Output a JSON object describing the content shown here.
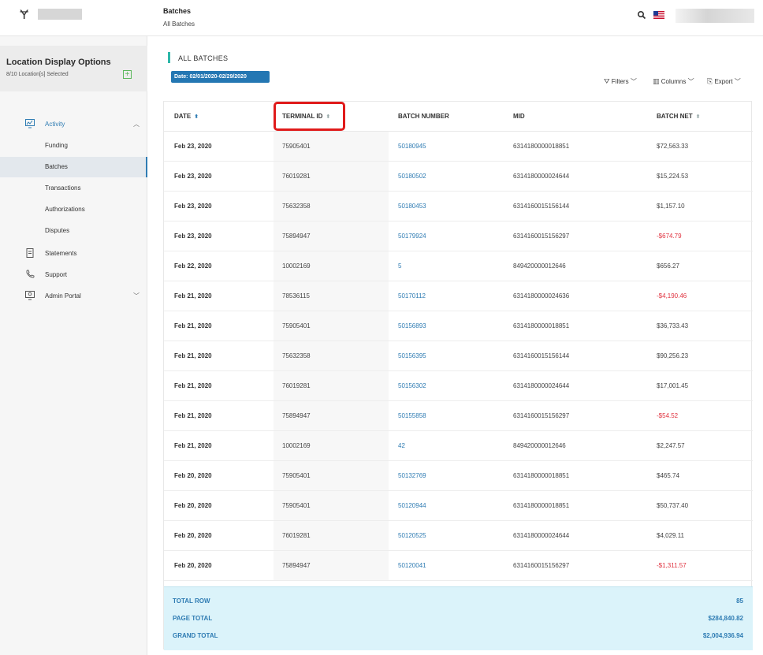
{
  "header": {
    "logo_glyph": "Ɏ",
    "title": "Batches",
    "subtitle": "All Batches"
  },
  "sidebar": {
    "location_title": "Location Display Options",
    "location_sub": "8/10 Location[s] Selected",
    "add_symbol": "+",
    "items": [
      {
        "label": "Activity",
        "icon": "monitor-chart-icon"
      },
      {
        "label": "Funding"
      },
      {
        "label": "Batches"
      },
      {
        "label": "Transactions"
      },
      {
        "label": "Authorizations"
      },
      {
        "label": "Disputes"
      },
      {
        "label": "Statements",
        "icon": "document-icon"
      },
      {
        "label": "Support",
        "icon": "phone-icon"
      },
      {
        "label": "Admin Portal",
        "icon": "admin-icon"
      }
    ]
  },
  "main": {
    "section_title": "ALL BATCHES",
    "date_filter": "Date: 02/01/2020-02/29/2020",
    "toolbar": {
      "filters": "Filters",
      "columns": "Columns",
      "export": "Export"
    },
    "columns": [
      "DATE",
      "TERMINAL ID",
      "BATCH NUMBER",
      "MID",
      "BATCH NET"
    ],
    "rows": [
      {
        "date": "Feb 23, 2020",
        "terminal": "75905401",
        "batch": "50180945",
        "mid": "6314180000018851",
        "net": "$72,563.33",
        "negative": false
      },
      {
        "date": "Feb 23, 2020",
        "terminal": "76019281",
        "batch": "50180502",
        "mid": "6314180000024644",
        "net": "$15,224.53",
        "negative": false
      },
      {
        "date": "Feb 23, 2020",
        "terminal": "75632358",
        "batch": "50180453",
        "mid": "6314160015156144",
        "net": "$1,157.10",
        "negative": false
      },
      {
        "date": "Feb 23, 2020",
        "terminal": "75894947",
        "batch": "50179924",
        "mid": "6314160015156297",
        "net": "-$674.79",
        "negative": true
      },
      {
        "date": "Feb 22, 2020",
        "terminal": "10002169",
        "batch": "5",
        "mid": "849420000012646",
        "net": "$656.27",
        "negative": false
      },
      {
        "date": "Feb 21, 2020",
        "terminal": "78536115",
        "batch": "50170112",
        "mid": "6314180000024636",
        "net": "-$4,190.46",
        "negative": true
      },
      {
        "date": "Feb 21, 2020",
        "terminal": "75905401",
        "batch": "50156893",
        "mid": "6314180000018851",
        "net": "$36,733.43",
        "negative": false
      },
      {
        "date": "Feb 21, 2020",
        "terminal": "75632358",
        "batch": "50156395",
        "mid": "6314160015156144",
        "net": "$90,256.23",
        "negative": false
      },
      {
        "date": "Feb 21, 2020",
        "terminal": "76019281",
        "batch": "50156302",
        "mid": "6314180000024644",
        "net": "$17,001.45",
        "negative": false
      },
      {
        "date": "Feb 21, 2020",
        "terminal": "75894947",
        "batch": "50155858",
        "mid": "6314160015156297",
        "net": "-$54.52",
        "negative": true
      },
      {
        "date": "Feb 21, 2020",
        "terminal": "10002169",
        "batch": "42",
        "mid": "849420000012646",
        "net": "$2,247.57",
        "negative": false
      },
      {
        "date": "Feb 20, 2020",
        "terminal": "75905401",
        "batch": "50132769",
        "mid": "6314180000018851",
        "net": "$465.74",
        "negative": false
      },
      {
        "date": "Feb 20, 2020",
        "terminal": "75905401",
        "batch": "50120944",
        "mid": "6314180000018851",
        "net": "$50,737.40",
        "negative": false
      },
      {
        "date": "Feb 20, 2020",
        "terminal": "76019281",
        "batch": "50120525",
        "mid": "6314180000024644",
        "net": "$4,029.11",
        "negative": false
      },
      {
        "date": "Feb 20, 2020",
        "terminal": "75894947",
        "batch": "50120041",
        "mid": "6314160015156297",
        "net": "-$1,311.57",
        "negative": true
      }
    ],
    "totals": [
      {
        "label": "TOTAL ROW",
        "value": "85"
      },
      {
        "label": "PAGE TOTAL",
        "value": "$284,840.82"
      },
      {
        "label": "GRAND TOTAL",
        "value": "$2,004,936.94"
      }
    ]
  },
  "colors": {
    "accent": "#2f7cb3",
    "negative": "#e0323f",
    "highlight": "#e01b1b",
    "totals_bg": "#dbf3fa"
  }
}
